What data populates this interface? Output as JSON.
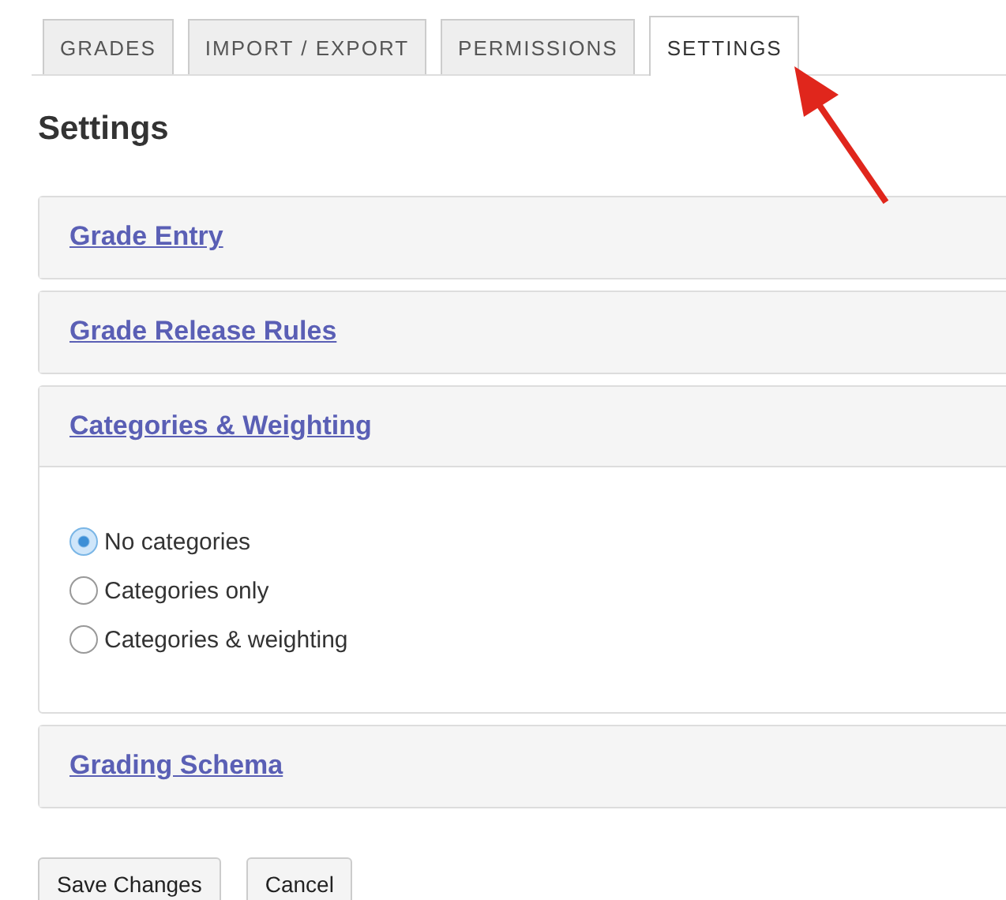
{
  "tabs": [
    {
      "label": "GRADES",
      "selected": false
    },
    {
      "label": "IMPORT / EXPORT",
      "selected": false
    },
    {
      "label": "PERMISSIONS",
      "selected": false
    },
    {
      "label": "SETTINGS",
      "selected": true
    }
  ],
  "heading": "Settings",
  "panels": [
    {
      "title": "Grade Entry",
      "expanded": false
    },
    {
      "title": "Grade Release Rules",
      "expanded": false
    },
    {
      "title": "Categories & Weighting",
      "expanded": true,
      "options": [
        {
          "label": "No categories",
          "selected": true
        },
        {
          "label": "Categories only",
          "selected": false
        },
        {
          "label": "Categories & weighting",
          "selected": false
        }
      ]
    },
    {
      "title": "Grading Schema",
      "expanded": false
    }
  ],
  "buttons": [
    "Save Changes",
    "Cancel"
  ]
}
